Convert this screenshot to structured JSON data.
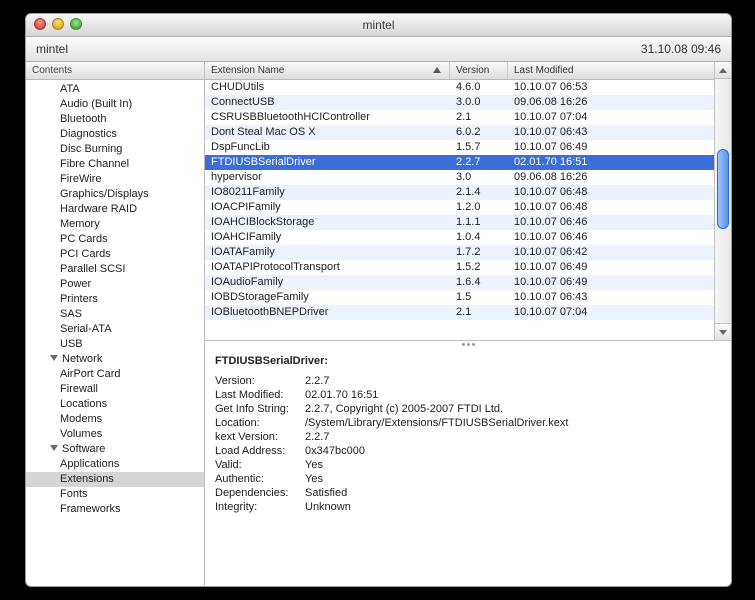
{
  "window": {
    "title": "mintel"
  },
  "toolbar": {
    "hostname": "mintel",
    "timestamp": "31.10.08 09:46"
  },
  "sidebar": {
    "header": "Contents",
    "hardware": [
      "ATA",
      "Audio (Built In)",
      "Bluetooth",
      "Diagnostics",
      "Disc Burning",
      "Fibre Channel",
      "FireWire",
      "Graphics/Displays",
      "Hardware RAID",
      "Memory",
      "PC Cards",
      "PCI Cards",
      "Parallel SCSI",
      "Power",
      "Printers",
      "SAS",
      "Serial-ATA",
      "USB"
    ],
    "network_label": "Network",
    "network": [
      "AirPort Card",
      "Firewall",
      "Locations",
      "Modems",
      "Volumes"
    ],
    "software_label": "Software",
    "software": [
      "Applications",
      "Extensions",
      "Fonts",
      "Frameworks"
    ],
    "selected": "Extensions"
  },
  "table": {
    "columns": {
      "name": "Extension Name",
      "version": "Version",
      "modified": "Last Modified"
    },
    "rows": [
      {
        "name": "CHUDUtils",
        "version": "4.6.0",
        "modified": "10.10.07 06:53"
      },
      {
        "name": "ConnectUSB",
        "version": "3.0.0",
        "modified": "09.06.08 16:26"
      },
      {
        "name": "CSRUSBBluetoothHCIController",
        "version": "2.1",
        "modified": "10.10.07 07:04"
      },
      {
        "name": "Dont Steal Mac OS X",
        "version": "6.0.2",
        "modified": "10.10.07 06:43"
      },
      {
        "name": "DspFuncLib",
        "version": "1.5.7",
        "modified": "10.10.07 06:49"
      },
      {
        "name": "FTDIUSBSerialDriver",
        "version": "2.2.7",
        "modified": "02.01.70 16:51",
        "selected": true
      },
      {
        "name": "hypervisor",
        "version": "3.0",
        "modified": "09.06.08 16:26"
      },
      {
        "name": "IO80211Family",
        "version": "2.1.4",
        "modified": "10.10.07 06:48"
      },
      {
        "name": "IOACPIFamily",
        "version": "1.2.0",
        "modified": "10.10.07 06:48"
      },
      {
        "name": "IOAHCIBlockStorage",
        "version": "1.1.1",
        "modified": "10.10.07 06:46"
      },
      {
        "name": "IOAHCIFamily",
        "version": "1.0.4",
        "modified": "10.10.07 06:46"
      },
      {
        "name": "IOATAFamily",
        "version": "1.7.2",
        "modified": "10.10.07 06:42"
      },
      {
        "name": "IOATAPIProtocolTransport",
        "version": "1.5.2",
        "modified": "10.10.07 06:49"
      },
      {
        "name": "IOAudioFamily",
        "version": "1.6.4",
        "modified": "10.10.07 06:49"
      },
      {
        "name": "IOBDStorageFamily",
        "version": "1.5",
        "modified": "10.10.07 06:43"
      },
      {
        "name": "IOBluetoothBNEPDriver",
        "version": "2.1",
        "modified": "10.10.07 07:04"
      }
    ]
  },
  "detail": {
    "title": "FTDIUSBSerialDriver:",
    "rows": [
      {
        "k": "Version:",
        "v": "2.2.7"
      },
      {
        "k": "Last Modified:",
        "v": "02.01.70 16:51"
      },
      {
        "k": "Get Info String:",
        "v": "2.2.7, Copyright (c) 2005-2007  FTDI Ltd."
      },
      {
        "k": "Location:",
        "v": "/System/Library/Extensions/FTDIUSBSerialDriver.kext"
      },
      {
        "k": "kext Version:",
        "v": "2.2.7"
      },
      {
        "k": "Load Address:",
        "v": "0x347bc000"
      },
      {
        "k": "Valid:",
        "v": "Yes"
      },
      {
        "k": "Authentic:",
        "v": "Yes"
      },
      {
        "k": "Dependencies:",
        "v": "Satisfied"
      },
      {
        "k": "Integrity:",
        "v": "Unknown"
      }
    ]
  }
}
